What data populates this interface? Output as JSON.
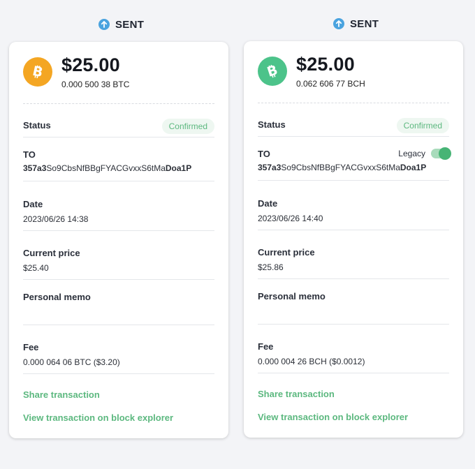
{
  "cards": [
    {
      "header": "SENT",
      "coin_icon": "bitcoin-icon",
      "coin_color": "#f4a623",
      "amount_fiat": "$25.00",
      "amount_crypto": "0.000 500 38 BTC",
      "status_label": "Status",
      "status_value": "Confirmed",
      "to_label": "TO",
      "to_address_prefix": "357a3",
      "to_address_middle": "So9CbsNfBBgFYACGvxxS6tMa",
      "to_address_suffix": "Doa1P",
      "date_label": "Date",
      "date_value": "2023/06/26 14:38",
      "price_label": "Current price",
      "price_value": "$25.40",
      "memo_label": "Personal memo",
      "fee_label": "Fee",
      "fee_value": "0.000 064 06 BTC ($3.20)",
      "share_link": "Share transaction",
      "explorer_link": "View transaction on block explorer"
    },
    {
      "header": "SENT",
      "coin_icon": "bitcoin-cash-icon",
      "coin_color": "#4cc38a",
      "amount_fiat": "$25.00",
      "amount_crypto": "0.062 606 77 BCH",
      "status_label": "Status",
      "status_value": "Confirmed",
      "to_label": "TO",
      "legacy_label": "Legacy",
      "legacy_on": true,
      "to_address_prefix": "357a3",
      "to_address_middle": "So9CbsNfBBgFYACGvxxS6tMa",
      "to_address_suffix": "Doa1P",
      "date_label": "Date",
      "date_value": "2023/06/26 14:40",
      "price_label": "Current price",
      "price_value": "$25.86",
      "memo_label": "Personal memo",
      "fee_label": "Fee",
      "fee_value": "0.000 004 26 BCH ($0.0012)",
      "share_link": "Share transaction",
      "explorer_link": "View transaction on block explorer"
    }
  ]
}
